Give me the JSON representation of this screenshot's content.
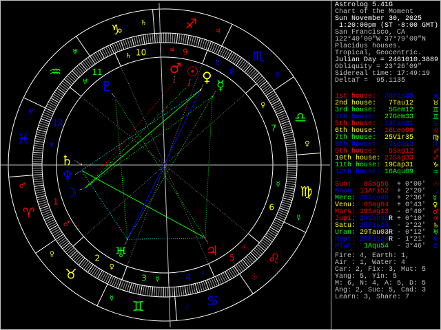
{
  "header": {
    "app": "Astrolog 5.41G",
    "chart_name": "Chart of the Moment",
    "date": "Sun November 30, 2025",
    "time": " 1:20:00pm (ST -8:00 GMT)",
    "location": "San Francisco, CA",
    "coords": "122°40'00\"W 37°79'00\"N",
    "houses": "Placidus houses.",
    "zodiac": "Tropical, Geocentric.",
    "julian": "Julian Day = 2461010.3889",
    "obliquity": "Obliquity = 23°26'09\"",
    "sidereal": "Sidereal time: 17:49:19",
    "deltat": "DeltaT =  95.1135"
  },
  "houses": [
    {
      "label": "1st house:",
      "pos": "25Pis35",
      "color": "#ff0000",
      "glyph": "♓",
      "glyph_color": "#0000ff"
    },
    {
      "label": "2nd house:",
      "pos": " 7Tau12",
      "color": "#ffff00",
      "glyph": "♉",
      "glyph_color": "#ffff00"
    },
    {
      "label": "3rd house:",
      "pos": " 5Gem12",
      "color": "#00ff00",
      "glyph": "♊",
      "glyph_color": "#00ff00"
    },
    {
      "label": "4th house:",
      "pos": "27Gem33",
      "color": "#0000ff",
      "glyph": "♊",
      "glyph_color": "#00ff00"
    },
    {
      "label": "5th house:",
      "pos": "19Can31",
      "color": "#ff0000",
      "glyph": "♋",
      "glyph_color": "#0000ff"
    },
    {
      "label": "6th house:",
      "pos": "16Leo09",
      "color": "#ffff00",
      "glyph": "♌",
      "glyph_color": "#ff0000"
    },
    {
      "label": "7th house:",
      "pos": "25Vir35",
      "color": "#00ff00",
      "glyph": "♍",
      "glyph_color": "#ffff00"
    },
    {
      "label": "8th house:",
      "pos": " 7Sco12",
      "color": "#0000ff",
      "glyph": "♏",
      "glyph_color": "#0000ff"
    },
    {
      "label": "9th house:",
      "pos": " 5Sag12",
      "color": "#ff0000",
      "glyph": "♐",
      "glyph_color": "#ff0000"
    },
    {
      "label": "10th house:",
      "pos": "27Sag33",
      "color": "#ffff00",
      "glyph": "♐",
      "glyph_color": "#ff0000"
    },
    {
      "label": "11th house:",
      "pos": "19Cap31",
      "color": "#00ff00",
      "glyph": "♑",
      "glyph_color": "#ffff00"
    },
    {
      "label": "12th house:",
      "pos": "16Aqu09",
      "color": "#0000ff",
      "glyph": "♒",
      "glyph_color": "#00ff00"
    }
  ],
  "planets": [
    {
      "name": "Sun:",
      "pos": " 8Sag56",
      "retro": "",
      "aspect": "+ 0°00'",
      "color": "#ff0000",
      "pos_color": "#ff0000",
      "glyph": "☉"
    },
    {
      "name": "Moon:",
      "pos": "11Ari52",
      "retro": "",
      "aspect": "+ 2°20'",
      "color": "#0000ff",
      "pos_color": "#ff0000",
      "glyph": "☽"
    },
    {
      "name": "Merc:",
      "pos": "20Sco49",
      "retro": "",
      "aspect": "+ 2°36'",
      "color": "#00ff00",
      "pos_color": "#0000ff",
      "glyph": "☿"
    },
    {
      "name": "Venu:",
      "pos": " 0Sag04",
      "retro": "",
      "aspect": "+ 0°43'",
      "color": "#ffff00",
      "pos_color": "#ff0000",
      "glyph": "♀"
    },
    {
      "name": "Mars:",
      "pos": "19Sag13",
      "retro": "",
      "aspect": "- 0°40'",
      "color": "#ff0000",
      "pos_color": "#ff0000",
      "glyph": "♂"
    },
    {
      "name": "Jupi:",
      "pos": "24Can32",
      "retro": "R",
      "aspect": "+ 0°10'",
      "color": "#ff0000",
      "pos_color": "#0000ff",
      "glyph": "♃"
    },
    {
      "name": "Satu:",
      "pos": "25Pis10",
      "retro": "",
      "aspect": "- 2°22'",
      "color": "#ffff00",
      "pos_color": "#0000ff",
      "glyph": "♄"
    },
    {
      "name": "Uran:",
      "pos": "29Tau03",
      "retro": "R",
      "aspect": "- 0°12'",
      "color": "#00ff00",
      "pos_color": "#ffff00",
      "glyph": "♅"
    },
    {
      "name": "Nept:",
      "pos": "29Pis24",
      "retro": "R",
      "aspect": "- 1°21'",
      "color": "#0000ff",
      "pos_color": "#0000ff",
      "glyph": "♆"
    },
    {
      "name": "Plut:",
      "pos": " 1Aqu54",
      "retro": "",
      "aspect": "- 3°46'",
      "color": "#0000ff",
      "pos_color": "#00ff00",
      "glyph": "♇"
    }
  ],
  "summary": [
    "Fire: 4, Earth: 1,",
    "Air : 1, Water: 4",
    "Car: 2, Fix: 3, Mut: 5",
    "Yang: 5, Yin: 5",
    "M: 6, N: 4, A: 5, D: 5",
    "Ang: 2, Suc: 5, Cad: 3",
    "Learn: 3, Share: 7"
  ],
  "signs": {
    "glyphs": [
      "♈",
      "♉",
      "♊",
      "♋",
      "♌",
      "♍",
      "♎",
      "♏",
      "♐",
      "♑",
      "♒",
      "♓"
    ],
    "colors": [
      "#ff0000",
      "#ffff00",
      "#00ff00",
      "#0000ff",
      "#ff0000",
      "#ffff00",
      "#00ff00",
      "#0000ff",
      "#ff0000",
      "#ffff00",
      "#00ff00",
      "#0000ff"
    ],
    "house_numbers": [
      "1",
      "2",
      "3",
      "4",
      "5",
      "6",
      "7",
      "8",
      "9",
      "10",
      "11",
      "12"
    ]
  }
}
